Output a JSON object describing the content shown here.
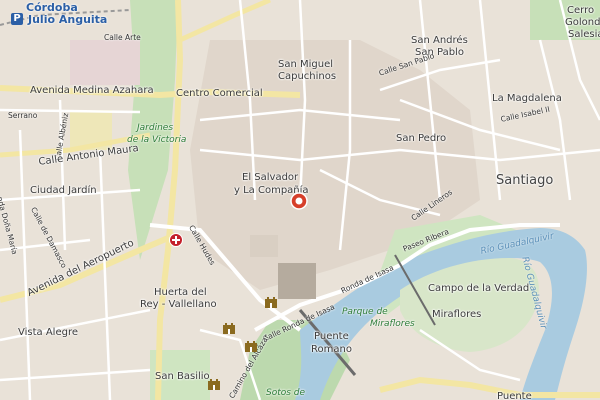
{
  "map": {
    "labels": {
      "cordoba": "Córdoba",
      "julio_anguita": "Julio Anguita",
      "calle_arte": "Calle Arte",
      "san_andres": "San Andrés",
      "san_pablo": "San Pablo",
      "cerro": "Cerro",
      "golondrina": "Golond",
      "salesia": "Salesia",
      "san_miguel": "San Miguel",
      "capuchinos": "Capuchinos",
      "calle_san_pablo": "Calle San Pablo",
      "avenida_medina": "Avenida Medina Azahara",
      "centro_comercial": "Centro Comercial",
      "la_magdalena": "La Magdalena",
      "serrano": "Serrano",
      "calle_albeniz": "Calle Albéniz",
      "jardines_1": "Jardines",
      "jardines_2": "de la Victoria",
      "calle_isabel": "Calle Isabel II",
      "san_pedro": "San Pedro",
      "calle_antonio_maura": "Calle Antonio Maura",
      "ciudad_jardin": "Ciudad Jardín",
      "el_salvador": "El Salvador",
      "la_compania": "y La Compañía",
      "santiago": "Santiago",
      "calle_lineros": "Calle Lineros",
      "calle_damasco": "Calle de Damasco",
      "ronda_dona_maria": "nda Doña María",
      "calle_hudes": "Calle Hudes",
      "paseo_ribera": "Paseo Ribera",
      "rio_1": "Río Guadalquivir",
      "rio_2": "Río Guadalquivir",
      "avenida_aeropuerto": "Avenida del Aeropuerto",
      "huerta_1": "Huerta del",
      "huerta_2": "Rey - Vallellano",
      "ronda_isasa": "Ronda de Isasa",
      "calle_ronda_isasa": "Calle Ronda de Isasa",
      "campo_1": "Campo de la Verdad",
      "campo_2": "Miraflores",
      "parque_1": "Parque de",
      "parque_2": "Miraflores",
      "vista_alegre": "Vista Alegre",
      "puente_1": "Puente",
      "puente_2": "Romano",
      "camino_alcazar": "Camino del Alcázar",
      "san_basilio": "San Basilio",
      "sotos": "Sotos de",
      "puente_bottom": "Puente"
    },
    "icons": {
      "station_badge": "P",
      "pin_color": "#d63f2a",
      "hospital_color": "#c4202b",
      "water_color": "#a9cbe0",
      "park_color": "#c7e0b8",
      "railway_color": "#999999"
    }
  }
}
